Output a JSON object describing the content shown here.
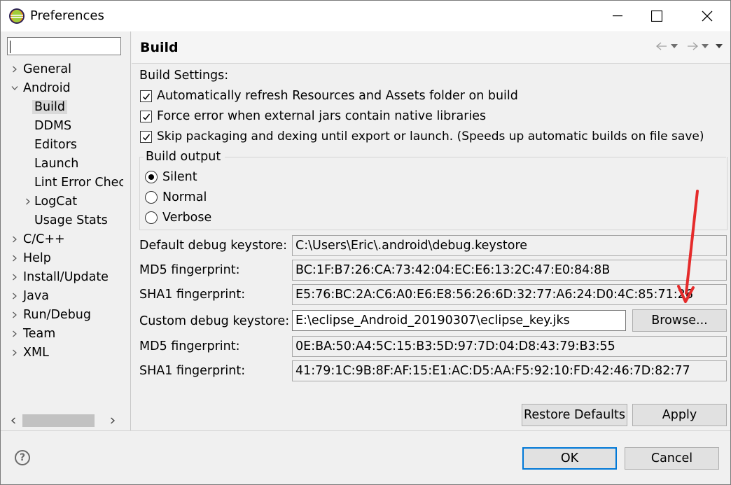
{
  "window": {
    "title": "Preferences"
  },
  "sidebar": {
    "filter_value": "",
    "items": [
      {
        "label": "General",
        "expander": "collapsed"
      },
      {
        "label": "Android",
        "expander": "expanded"
      },
      {
        "label": "Build",
        "selected": true
      },
      {
        "label": "DDMS"
      },
      {
        "label": "Editors"
      },
      {
        "label": "Launch"
      },
      {
        "label": "Lint Error Chec"
      },
      {
        "label": "LogCat",
        "expander": "collapsed"
      },
      {
        "label": "Usage Stats"
      },
      {
        "label": "C/C++",
        "expander": "collapsed"
      },
      {
        "label": "Help",
        "expander": "collapsed"
      },
      {
        "label": "Install/Update",
        "expander": "collapsed"
      },
      {
        "label": "Java",
        "expander": "collapsed"
      },
      {
        "label": "Run/Debug",
        "expander": "collapsed"
      },
      {
        "label": "Team",
        "expander": "collapsed"
      },
      {
        "label": "XML",
        "expander": "collapsed"
      }
    ]
  },
  "page": {
    "title": "Build",
    "settings_label": "Build Settings:",
    "checkboxes": [
      {
        "label": "Automatically refresh Resources and Assets folder on build",
        "checked": true
      },
      {
        "label": "Force error when external jars contain native libraries",
        "checked": true
      },
      {
        "label": "Skip packaging and dexing until export or launch. (Speeds up automatic builds on file save)",
        "checked": true
      }
    ],
    "build_output": {
      "legend": "Build output",
      "options": [
        {
          "label": "Silent",
          "selected": true
        },
        {
          "label": "Normal",
          "selected": false
        },
        {
          "label": "Verbose",
          "selected": false
        }
      ]
    },
    "fields": [
      {
        "label": "Default debug keystore:",
        "value": "C:\\Users\\Eric\\.android\\debug.keystore"
      },
      {
        "label": "MD5 fingerprint:",
        "value": "BC:1F:B7:26:CA:73:42:04:EC:E6:13:2C:47:E0:84:8B"
      },
      {
        "label": "SHA1 fingerprint:",
        "value": "E5:76:BC:2A:C6:A0:E6:E8:56:26:6D:32:77:A6:24:D0:4C:85:71:26"
      },
      {
        "label": "Custom debug keystore:",
        "value": "E:\\eclipse_Android_20190307\\eclipse_key.jks"
      },
      {
        "label": "MD5 fingerprint:",
        "value": "0E:BA:50:A4:5C:15:B3:5D:97:7D:04:D8:43:79:B3:55"
      },
      {
        "label": "SHA1 fingerprint:",
        "value": "41:79:1C:9B:8F:AF:15:E1:AC:D5:AA:F5:92:10:FD:42:46:7D:82:77"
      }
    ],
    "browse_label": "Browse...",
    "restore_defaults_label": "Restore Defaults",
    "apply_label": "Apply"
  },
  "footer": {
    "ok_label": "OK",
    "cancel_label": "Cancel",
    "help_glyph": "?"
  },
  "colors": {
    "annotation_arrow": "#e52b2b",
    "default_button_border": "#0078d7"
  }
}
